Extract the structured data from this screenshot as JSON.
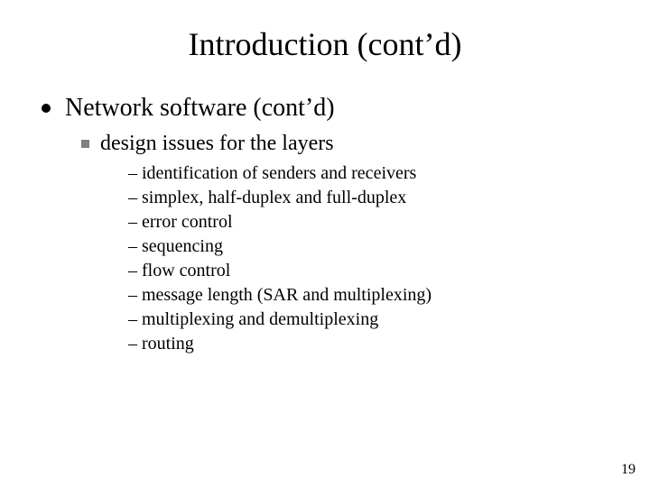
{
  "title": "Introduction (cont’d)",
  "l1": {
    "text": "Network software (cont’d)"
  },
  "l2": {
    "text": "design issues for the layers"
  },
  "l3": [
    "– identification of senders and receivers",
    "– simplex, half-duplex and full-duplex",
    "– error control",
    "– sequencing",
    "– flow control",
    "– message length (SAR and multiplexing)",
    "– multiplexing and demultiplexing",
    "– routing"
  ],
  "page_number": "19"
}
